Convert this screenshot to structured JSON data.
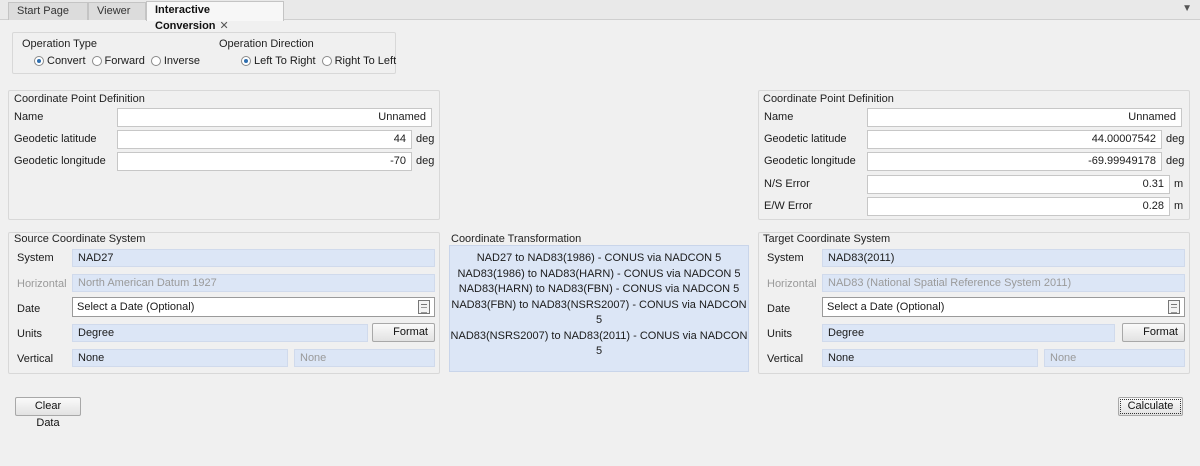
{
  "tabs": [
    {
      "label": "Start Page"
    },
    {
      "label": "Viewer"
    },
    {
      "label": "Interactive Conversion",
      "active": true
    }
  ],
  "operation_type": {
    "title": "Operation Type",
    "options": [
      "Convert",
      "Forward",
      "Inverse"
    ],
    "selected": "Convert"
  },
  "operation_direction": {
    "title": "Operation Direction",
    "options": [
      "Left To Right",
      "Right To Left"
    ],
    "selected": "Left To Right"
  },
  "source_point": {
    "title": "Coordinate Point Definition",
    "name_label": "Name",
    "name_value": "Unnamed",
    "lat_label": "Geodetic latitude",
    "lat_value": "44",
    "lat_unit": "deg",
    "lon_label": "Geodetic longitude",
    "lon_value": "-70",
    "lon_unit": "deg"
  },
  "target_point": {
    "title": "Coordinate Point Definition",
    "name_label": "Name",
    "name_value": "Unnamed",
    "lat_label": "Geodetic latitude",
    "lat_value": "44.00007542",
    "lat_unit": "deg",
    "lon_label": "Geodetic longitude",
    "lon_value": "-69.99949178",
    "lon_unit": "deg",
    "ns_label": "N/S Error",
    "ns_value": "0.31",
    "ns_unit": "m",
    "ew_label": "E/W Error",
    "ew_value": "0.28",
    "ew_unit": "m"
  },
  "source_system": {
    "title": "Source Coordinate System",
    "system_label": "System",
    "system_value": "NAD27",
    "horizontal_label": "Horizontal",
    "horizontal_value": "North American Datum 1927",
    "date_label": "Date",
    "date_placeholder": "Select a Date (Optional)",
    "units_label": "Units",
    "units_value": "Degree",
    "format_label": "Format",
    "vertical_label": "Vertical",
    "vertical_value": "None",
    "vertical_extra": "None"
  },
  "transformation": {
    "title": "Coordinate Transformation",
    "steps": [
      "NAD27 to NAD83(1986) - CONUS via NADCON 5",
      "NAD83(1986) to NAD83(HARN) - CONUS via NADCON 5",
      "NAD83(HARN) to NAD83(FBN) - CONUS via NADCON 5",
      "NAD83(FBN) to NAD83(NSRS2007) - CONUS via NADCON 5",
      "NAD83(NSRS2007) to NAD83(2011) - CONUS via NADCON 5"
    ]
  },
  "target_system": {
    "title": "Target Coordinate System",
    "system_label": "System",
    "system_value": "NAD83(2011)",
    "horizontal_label": "Horizontal",
    "horizontal_value": "NAD83 (National Spatial Reference System 2011)",
    "date_label": "Date",
    "date_placeholder": "Select a Date (Optional)",
    "units_label": "Units",
    "units_value": "Degree",
    "format_label": "Format",
    "vertical_label": "Vertical",
    "vertical_value": "None",
    "vertical_extra": "None"
  },
  "actions": {
    "clear_label": "Clear Data",
    "calculate_label": "Calculate"
  }
}
